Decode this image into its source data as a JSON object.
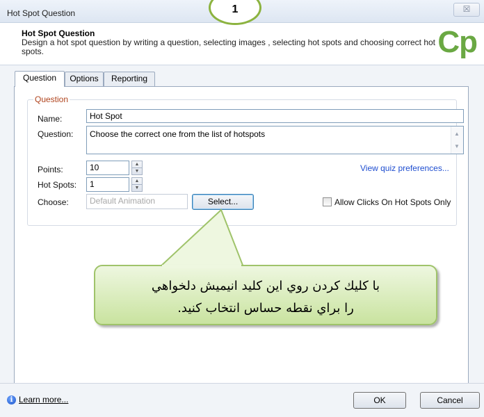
{
  "window": {
    "title": "Hot Spot Question",
    "close_symbol": "☒"
  },
  "header": {
    "title": "Hot Spot Question",
    "description": "Design a hot spot question by writing a question, selecting images , selecting hot spots and choosing correct hot spots.",
    "logo_text": "Cp",
    "logo_color": "#6aa843"
  },
  "tabs": [
    {
      "label": "Question",
      "active": true
    },
    {
      "label": "Options",
      "active": false
    },
    {
      "label": "Reporting",
      "active": false
    }
  ],
  "question_group": {
    "legend": "Question",
    "name_label": "Name:",
    "name_value": "Hot Spot",
    "question_label": "Question:",
    "question_value": "Choose the correct one from the list of hotspots",
    "points_label": "Points:",
    "points_value": "10",
    "hotspots_label": "Hot Spots:",
    "hotspots_value": "1",
    "choose_label": "Choose:",
    "choose_placeholder": "Default Animation",
    "select_button": "Select...",
    "preferences_link": "View quiz preferences...",
    "allow_clicks_label": "Allow Clicks On Hot Spots Only",
    "allow_clicks_checked": false
  },
  "callout": {
    "line1": "با كليك كردن روي اين كليد انيميش دلخواهي",
    "line2": "را براي نقطه حساس انتخاب كنيد.",
    "accent": "#9fc36a"
  },
  "step_marker": {
    "number": "1",
    "color": "#8cb33f"
  },
  "footer": {
    "info_icon": "info-icon",
    "learn_more": "Learn more...",
    "ok_button": "OK",
    "cancel_button": "Cancel"
  }
}
